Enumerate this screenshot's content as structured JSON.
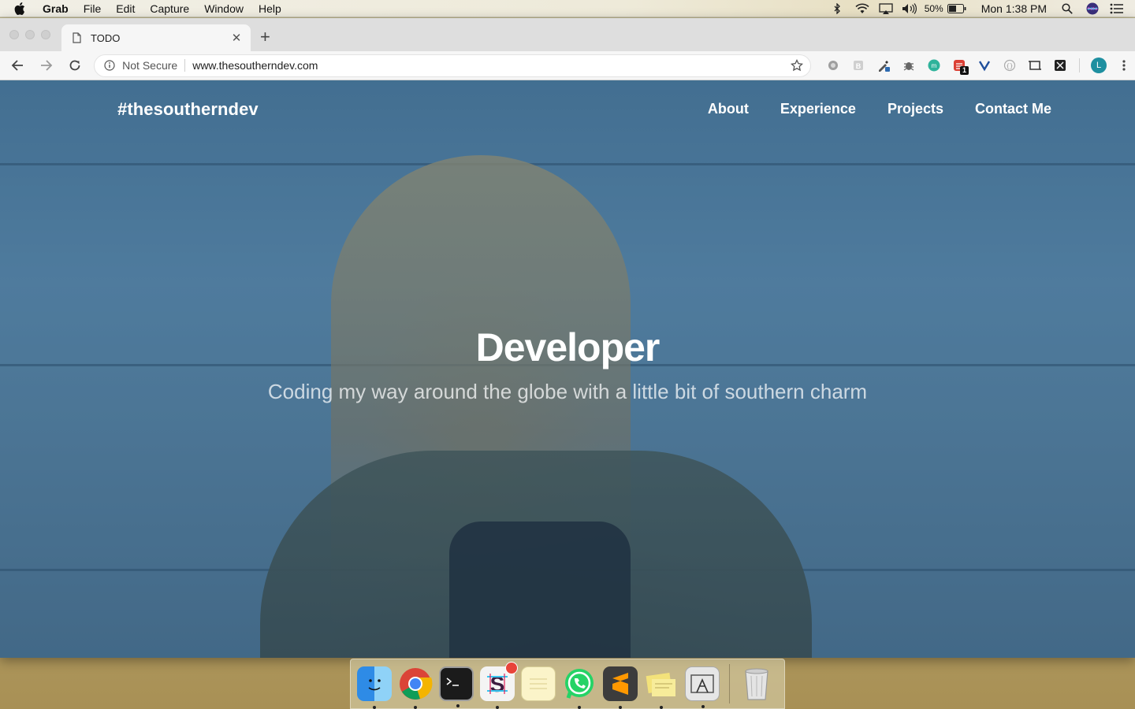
{
  "menubar": {
    "app_name": "Grab",
    "menus": [
      "File",
      "Edit",
      "Capture",
      "Window",
      "Help"
    ],
    "battery_percent": "50%",
    "clock": "Mon 1:38 PM",
    "status_icons": [
      "bluetooth-icon",
      "wifi-icon",
      "airplay-icon",
      "volume-icon",
      "battery-icon",
      "spotlight-icon",
      "siri-icon",
      "notification-center-icon"
    ]
  },
  "browser": {
    "tab": {
      "title": "TODO",
      "close_glyph": "✕"
    },
    "new_tab_glyph": "+",
    "omnibox": {
      "security_label": "Not Secure",
      "url": "www.thesoutherndev.com"
    },
    "profile_initial": "L",
    "extension_badges": {
      "todoist": "1"
    }
  },
  "site": {
    "brand": "#thesoutherndev",
    "nav": [
      "About",
      "Experience",
      "Projects",
      "Contact Me"
    ],
    "hero": {
      "title": "Developer",
      "subtitle": "Coding my way around the globe with a little bit of southern charm"
    }
  },
  "dock": {
    "apps": [
      "finder-icon",
      "chrome-icon",
      "terminal-icon",
      "slack-icon",
      "notes-icon",
      "whatsapp-icon",
      "sublime-text-icon",
      "stickies-icon",
      "grab-icon"
    ],
    "trash": "trash-icon"
  }
}
